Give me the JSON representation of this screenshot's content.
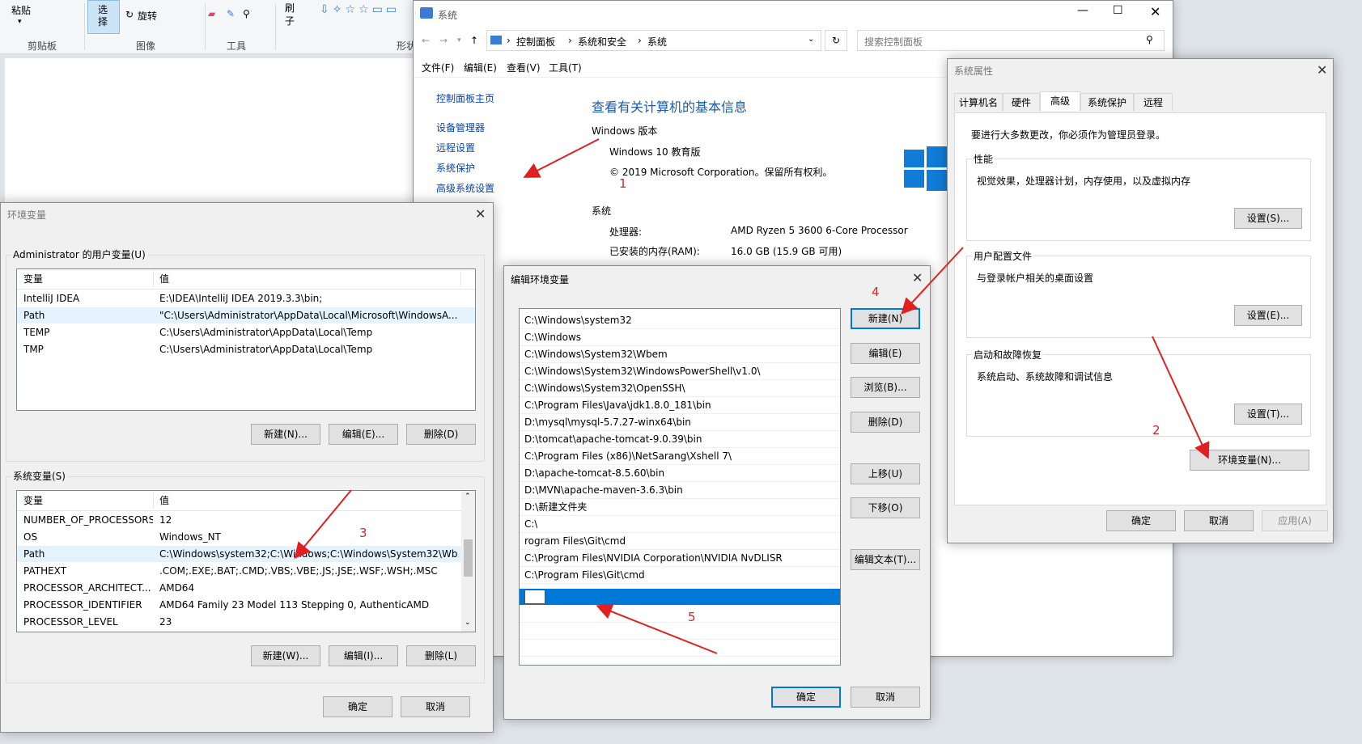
{
  "paint": {
    "groups": {
      "clipboard": "剪贴板",
      "image": "图像",
      "tools": "工具",
      "shapes": "形状"
    },
    "buttons": {
      "paste": "粘贴",
      "select": "选\n择",
      "rotate": "旋转",
      "brush": "刷\n子"
    }
  },
  "system_window": {
    "title": "系统",
    "breadcrumb": [
      "控制面板",
      "系统和安全",
      "系统"
    ],
    "search_placeholder": "搜索控制面板",
    "menu": [
      "文件(F)",
      "编辑(E)",
      "查看(V)",
      "工具(T)"
    ],
    "left_nav": [
      "控制面板主页",
      "设备管理器",
      "远程设置",
      "系统保护",
      "高级系统设置"
    ],
    "heading": "查看有关计算机的基本信息",
    "windows_edition_label": "Windows 版本",
    "edition": "Windows 10 教育版",
    "copyright": "© 2019 Microsoft Corporation。保留所有权利。",
    "system_label": "系统",
    "processor_label": "处理器:",
    "processor_value": "AMD Ryzen 5 3600 6-Core Processor",
    "ram_label": "已安装的内存(RAM):",
    "ram_value": "16.0 GB (15.9 GB 可用)"
  },
  "sys_props": {
    "title": "系统属性",
    "tabs": [
      "计算机名",
      "硬件",
      "高级",
      "系统保护",
      "远程"
    ],
    "active_tab": "高级",
    "admin_note": "要进行大多数更改，你必须作为管理员登录。",
    "performance": {
      "label": "性能",
      "desc": "视觉效果，处理器计划，内存使用，以及虚拟内存",
      "button": "设置(S)..."
    },
    "profile": {
      "label": "用户配置文件",
      "desc": "与登录帐户相关的桌面设置",
      "button": "设置(E)..."
    },
    "startup": {
      "label": "启动和故障恢复",
      "desc": "系统启动、系统故障和调试信息",
      "button": "设置(T)..."
    },
    "env_button": "环境变量(N)...",
    "ok": "确定",
    "cancel": "取消",
    "apply": "应用(A)"
  },
  "env_vars": {
    "title": "环境变量",
    "user_group": "Administrator 的用户变量(U)",
    "col_var": "变量",
    "col_val": "值",
    "user_rows": [
      {
        "name": "IntelliJ IDEA",
        "value": "E:\\IDEA\\IntelliJ IDEA 2019.3.3\\bin;"
      },
      {
        "name": "Path",
        "value": "\"C:\\Users\\Administrator\\AppData\\Local\\Microsoft\\WindowsA..."
      },
      {
        "name": "TEMP",
        "value": "C:\\Users\\Administrator\\AppData\\Local\\Temp"
      },
      {
        "name": "TMP",
        "value": "C:\\Users\\Administrator\\AppData\\Local\\Temp"
      }
    ],
    "user_buttons": [
      "新建(N)...",
      "编辑(E)...",
      "删除(D)"
    ],
    "system_group": "系统变量(S)",
    "system_rows": [
      {
        "name": "NUMBER_OF_PROCESSORS",
        "value": "12"
      },
      {
        "name": "OS",
        "value": "Windows_NT"
      },
      {
        "name": "Path",
        "value": "C:\\Windows\\system32;C:\\Windows;C:\\Windows\\System32\\Wb..."
      },
      {
        "name": "PATHEXT",
        "value": ".COM;.EXE;.BAT;.CMD;.VBS;.VBE;.JS;.JSE;.WSF;.WSH;.MSC"
      },
      {
        "name": "PROCESSOR_ARCHITECT...",
        "value": "AMD64"
      },
      {
        "name": "PROCESSOR_IDENTIFIER",
        "value": "AMD64 Family 23 Model 113 Stepping 0, AuthenticAMD"
      },
      {
        "name": "PROCESSOR_LEVEL",
        "value": "23"
      }
    ],
    "system_buttons": [
      "新建(W)...",
      "编辑(I)...",
      "删除(L)"
    ],
    "ok": "确定",
    "cancel": "取消"
  },
  "edit_env": {
    "title": "编辑环境变量",
    "paths": [
      "C:\\Windows\\system32",
      "C:\\Windows",
      "C:\\Windows\\System32\\Wbem",
      "C:\\Windows\\System32\\WindowsPowerShell\\v1.0\\",
      "C:\\Windows\\System32\\OpenSSH\\",
      "C:\\Program Files\\Java\\jdk1.8.0_181\\bin",
      "D:\\mysql\\mysql-5.7.27-winx64\\bin",
      "D:\\tomcat\\apache-tomcat-9.0.39\\bin",
      "C:\\Program Files (x86)\\NetSarang\\Xshell 7\\",
      "D:\\apache-tomcat-8.5.60\\bin",
      "D:\\MVN\\apache-maven-3.6.3\\bin",
      "D:\\新建文件夹",
      "C:\\",
      "rogram Files\\Git\\cmd",
      "C:\\Program Files\\NVIDIA Corporation\\NVIDIA NvDLISR",
      "C:\\Program Files\\Git\\cmd"
    ],
    "buttons": [
      "新建(N)",
      "编辑(E)",
      "浏览(B)...",
      "删除(D)",
      "上移(U)",
      "下移(O)",
      "编辑文本(T)..."
    ],
    "ok": "确定",
    "cancel": "取消"
  },
  "annotations": [
    "1",
    "2",
    "3",
    "4",
    "5"
  ],
  "colors": {
    "accent": "#0078d7",
    "annotation": "#e02020",
    "link": "#0645ad",
    "heading": "#1e5aa8"
  }
}
